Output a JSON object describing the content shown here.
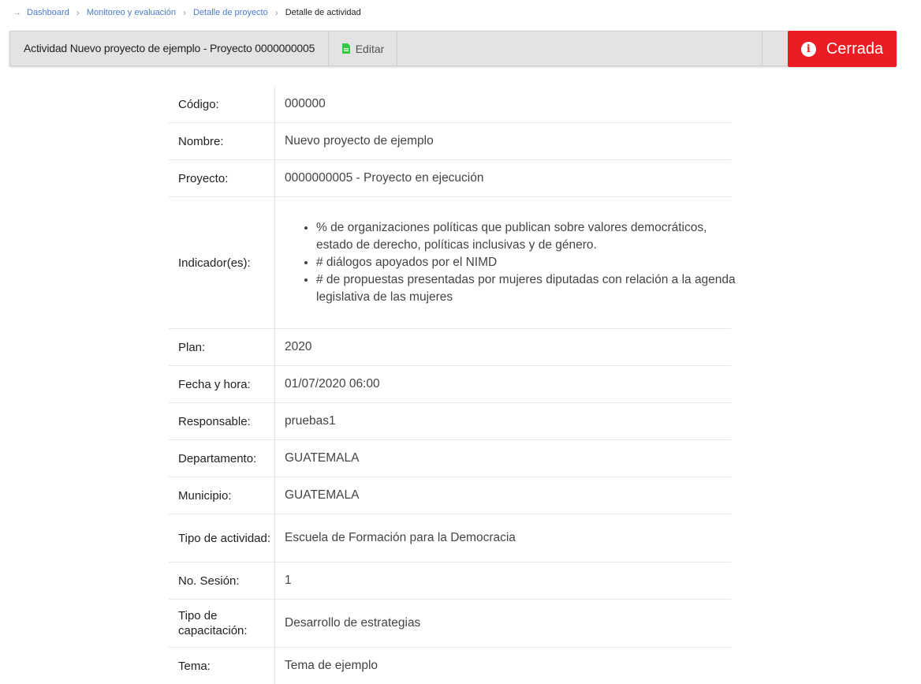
{
  "breadcrumb": {
    "items": [
      "Dashboard",
      "Monitoreo y evaluación",
      "Detalle de proyecto"
    ],
    "current": "Detalle de actividad"
  },
  "toolbar": {
    "title": "Actividad Nuevo proyecto de ejemplo - Proyecto 0000000005",
    "edit_label": "Editar",
    "status_label": "Cerrada",
    "status_color": "#ec1c24"
  },
  "details": {
    "codigo": {
      "label": "Código:",
      "value": "000000"
    },
    "nombre": {
      "label": "Nombre:",
      "value": "Nuevo proyecto de ejemplo"
    },
    "proyecto": {
      "label": "Proyecto:",
      "value": "0000000005 - Proyecto en ejecución"
    },
    "indicadores": {
      "label": "Indicador(es):",
      "items": [
        "% de organizaciones políticas que publican sobre valores democráticos, estado de derecho, políticas inclusivas y de género.",
        "# diálogos apoyados por el NIMD",
        "# de propuestas presentadas por mujeres diputadas con relación a la agenda legislativa de las mujeres"
      ]
    },
    "plan": {
      "label": "Plan:",
      "value": "2020"
    },
    "fecha": {
      "label": "Fecha y hora:",
      "value": "01/07/2020 06:00"
    },
    "responsable": {
      "label": "Responsable:",
      "value": "pruebas1"
    },
    "departamento": {
      "label": "Departamento:",
      "value": "GUATEMALA"
    },
    "municipio": {
      "label": "Municipio:",
      "value": "GUATEMALA"
    },
    "tipo_actividad": {
      "label": "Tipo de actividad:",
      "value": "Escuela de Formación para la Democracia"
    },
    "sesion": {
      "label": "No. Sesión:",
      "value": "1"
    },
    "tipo_capacitacion": {
      "label": "Tipo de capacitación:",
      "value": "Desarrollo de estrategias"
    },
    "tema": {
      "label": "Tema:",
      "value": "Tema de ejemplo"
    }
  }
}
